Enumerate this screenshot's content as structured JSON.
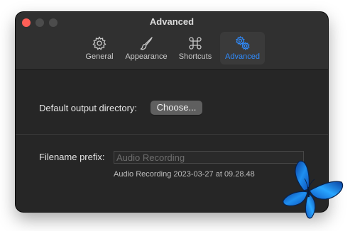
{
  "window": {
    "title": "Advanced"
  },
  "tabs": [
    {
      "label": "General",
      "icon": "gear-icon",
      "active": false
    },
    {
      "label": "Appearance",
      "icon": "paintbrush-icon",
      "active": false
    },
    {
      "label": "Shortcuts",
      "icon": "command-icon",
      "active": false
    },
    {
      "label": "Advanced",
      "icon": "gears-icon",
      "active": true
    }
  ],
  "output": {
    "label": "Default output directory:",
    "button_label": "Choose..."
  },
  "prefix": {
    "label": "Filename prefix:",
    "placeholder": "Audio Recording",
    "value": "",
    "preview": "Audio Recording 2023-03-27 at 09.28.48"
  },
  "colors": {
    "window_bg": "#262626",
    "toolbar_bg": "#303030",
    "accent": "#2f8cff",
    "close_button": "#ff5f57"
  }
}
